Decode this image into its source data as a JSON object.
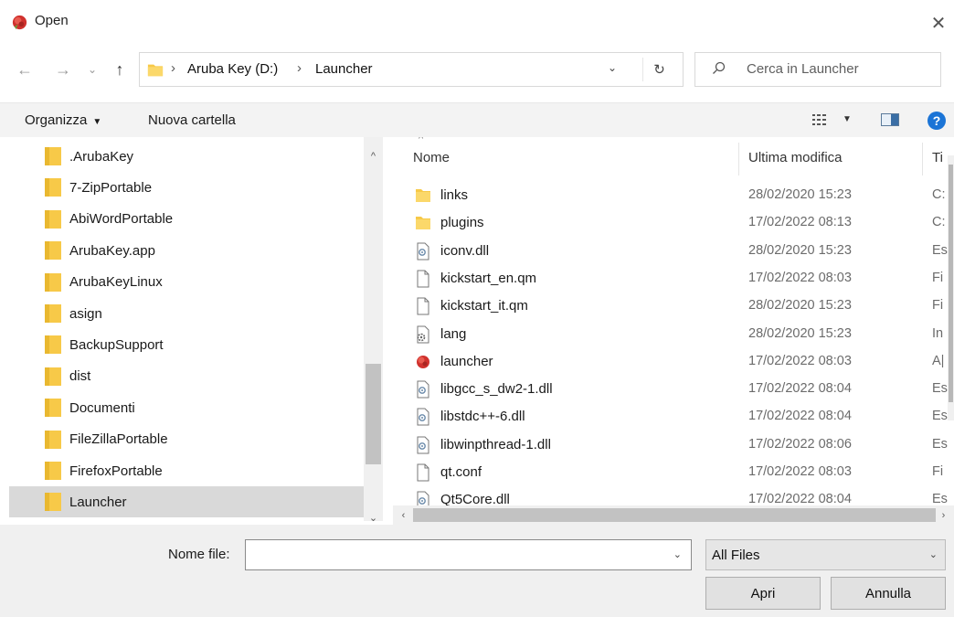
{
  "window": {
    "title": "Open",
    "close_glyph": "✕"
  },
  "nav": {
    "back": "←",
    "forward": "→",
    "recent": "⌄",
    "up": "↑"
  },
  "address": {
    "crumbs": [
      "Aruba Key (D:)",
      "Launcher"
    ],
    "separator": "›",
    "dropdown": "⌄",
    "refresh": "↻"
  },
  "search": {
    "placeholder": "Cerca in Launcher"
  },
  "toolbar": {
    "organize": "Organizza",
    "organize_caret": "▼",
    "new_folder": "Nuova cartella",
    "view_caret": "▼",
    "help": "?"
  },
  "sidebar": {
    "items": [
      {
        "label": ".ArubaKey"
      },
      {
        "label": "7-ZipPortable"
      },
      {
        "label": "AbiWordPortable"
      },
      {
        "label": "ArubaKey.app"
      },
      {
        "label": "ArubaKeyLinux"
      },
      {
        "label": "asign"
      },
      {
        "label": "BackupSupport"
      },
      {
        "label": "dist"
      },
      {
        "label": "Documenti"
      },
      {
        "label": "FileZillaPortable"
      },
      {
        "label": "FirefoxPortable"
      },
      {
        "label": "Launcher",
        "selected": true
      }
    ]
  },
  "filelist": {
    "columns": {
      "name": "Nome",
      "modified": "Ultima modifica",
      "type": "Ti"
    },
    "sort_glyph": "^",
    "rows": [
      {
        "name": "links",
        "date": "28/02/2020 15:23",
        "type": "C:",
        "icon": "folder"
      },
      {
        "name": "plugins",
        "date": "17/02/2022 08:13",
        "type": "C:",
        "icon": "folder"
      },
      {
        "name": "iconv.dll",
        "date": "28/02/2020 15:23",
        "type": "Es",
        "icon": "dll"
      },
      {
        "name": "kickstart_en.qm",
        "date": "17/02/2022 08:03",
        "type": "Fi",
        "icon": "file"
      },
      {
        "name": "kickstart_it.qm",
        "date": "28/02/2020 15:23",
        "type": "Fi",
        "icon": "file"
      },
      {
        "name": "lang",
        "date": "28/02/2020 15:23",
        "type": "In",
        "icon": "ini"
      },
      {
        "name": "launcher",
        "date": "17/02/2022 08:03",
        "type": "A|",
        "icon": "app"
      },
      {
        "name": "libgcc_s_dw2-1.dll",
        "date": "17/02/2022 08:04",
        "type": "Es",
        "icon": "dll"
      },
      {
        "name": "libstdc++-6.dll",
        "date": "17/02/2022 08:04",
        "type": "Es",
        "icon": "dll"
      },
      {
        "name": "libwinpthread-1.dll",
        "date": "17/02/2022 08:06",
        "type": "Es",
        "icon": "dll"
      },
      {
        "name": "qt.conf",
        "date": "17/02/2022 08:03",
        "type": "Fi",
        "icon": "file"
      },
      {
        "name": "Qt5Core.dll",
        "date": "17/02/2022 08:04",
        "type": "Es",
        "icon": "dll"
      }
    ]
  },
  "bottom": {
    "filename_label": "Nome file:",
    "filename_value": "",
    "filetype": "All Files",
    "open": "Apri",
    "cancel": "Annulla",
    "dropdown": "⌄"
  },
  "colors": {
    "folder": "#f7c948",
    "accent": "#1b74d6",
    "app_icon": "#d0312d",
    "selected": "#d9d9d9"
  }
}
